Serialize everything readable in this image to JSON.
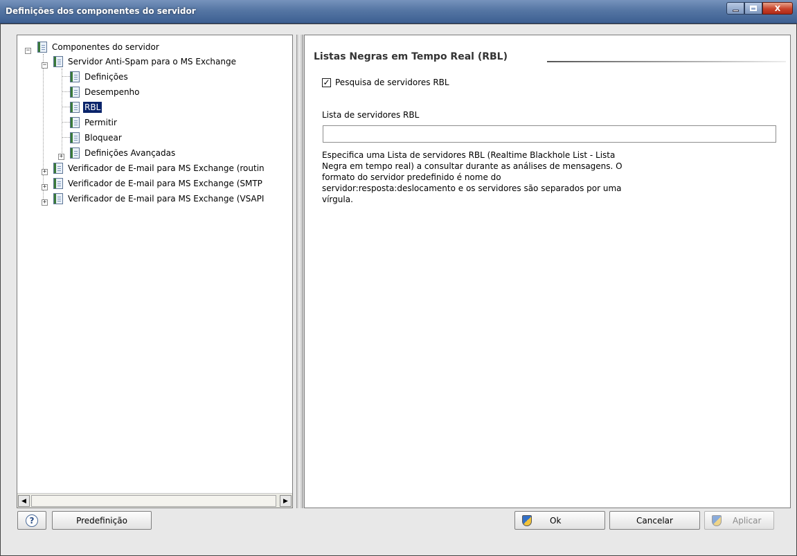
{
  "window": {
    "title": "Definições dos componentes do servidor",
    "minimize_glyph": "",
    "maximize_glyph": "",
    "close_glyph": "X"
  },
  "tree": {
    "items": [
      {
        "label": "Componentes do servidor",
        "expander": "−"
      },
      {
        "label": "Servidor Anti-Spam para o MS Exchange",
        "expander": "−"
      },
      {
        "label": "Definições"
      },
      {
        "label": "Desempenho"
      },
      {
        "label": "RBL",
        "selected": true
      },
      {
        "label": "Permitir"
      },
      {
        "label": "Bloquear"
      },
      {
        "label": "Definições Avançadas",
        "expander": "+"
      },
      {
        "label": "Verificador de E-mail para MS Exchange (routin",
        "expander": "+"
      },
      {
        "label": "Verificador de E-mail para MS Exchange (SMTP",
        "expander": "+"
      },
      {
        "label": "Verificador de E-mail para MS Exchange (VSAPI",
        "expander": "+"
      }
    ],
    "scroll_left": "◀",
    "scroll_right": "▶"
  },
  "panel": {
    "title": "Listas Negras em Tempo Real (RBL)",
    "checkbox_label": "Pesquisa de servidores RBL",
    "checkbox_checked": true,
    "checkbox_mark": "✓",
    "field_label": "Lista de servidores RBL",
    "field_value": "",
    "description": "Especifica uma Lista de servidores RBL (Realtime Blackhole List - Lista Negra em tempo real) a consultar durante as análises de mensagens. O formato do servidor predefinido é nome do servidor:resposta:deslocamento e os servidores são separados por uma vírgula."
  },
  "buttons": {
    "help_glyph": "?",
    "default_label": "Predefinição",
    "ok_label": "Ok",
    "cancel_label": "Cancelar",
    "apply_label": "Aplicar"
  },
  "colors": {
    "selection": "#0a246a",
    "titlebar": "#5576a4"
  }
}
